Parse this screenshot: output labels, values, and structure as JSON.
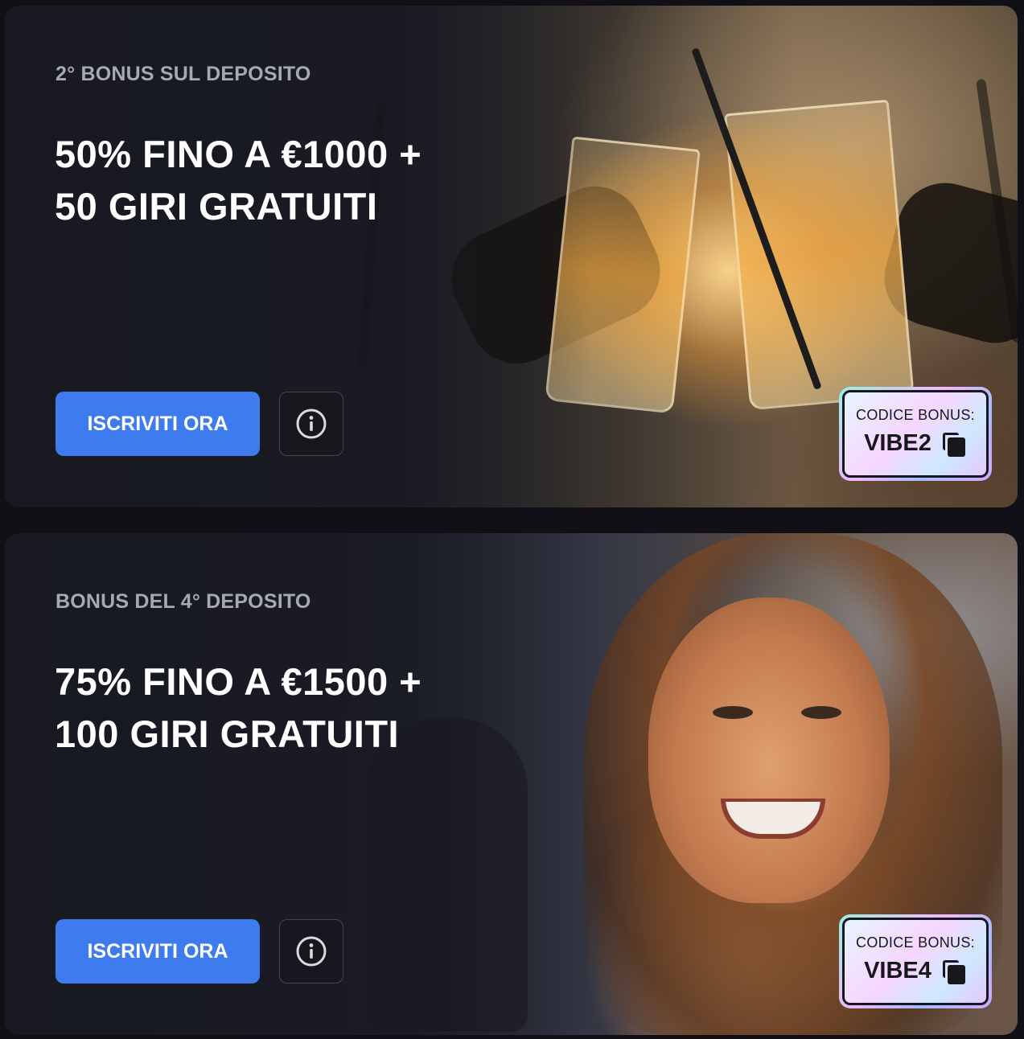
{
  "offers": [
    {
      "subtitle": "2° BONUS SUL DEPOSITO",
      "headline_line1": "50% FINO A €1000 +",
      "headline_line2": "50 GIRI GRATUITI",
      "cta_label": "ISCRIVITI ORA",
      "info_icon": "info-icon",
      "code_label": "CODICE BONUS:",
      "code_value": "VIBE2",
      "copy_icon": "copy-icon"
    },
    {
      "subtitle": "BONUS DEL 4° DEPOSITO",
      "headline_line1": "75% FINO A €1500 +",
      "headline_line2": "100 GIRI GRATUITI",
      "cta_label": "ISCRIVITI ORA",
      "info_icon": "info-icon",
      "code_label": "CODICE BONUS:",
      "code_value": "VIBE4",
      "copy_icon": "copy-icon"
    }
  ],
  "colors": {
    "page_background": "#101016",
    "cta_blue": "#3e7bef",
    "headline_white": "#ffffff",
    "subtitle_gray": "#a7a9b0"
  }
}
